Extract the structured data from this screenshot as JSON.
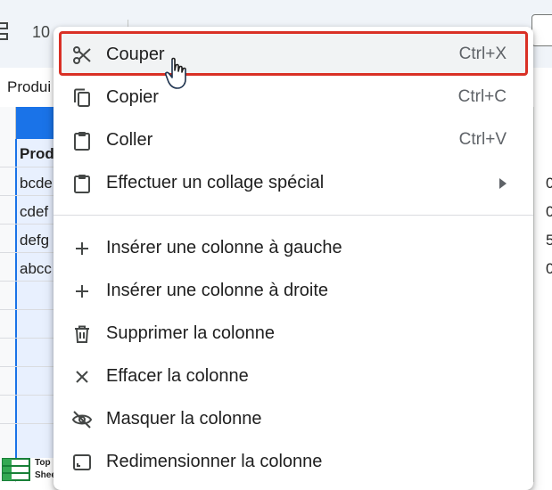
{
  "toolbar": {
    "zoom_label": "10"
  },
  "name_box": {
    "text": "Produi"
  },
  "sheet": {
    "cells": [
      {
        "text": "Prod",
        "bold": true
      },
      {
        "text": "bcde",
        "bold": false
      },
      {
        "text": "cdef",
        "bold": false
      },
      {
        "text": "defg",
        "bold": false
      },
      {
        "text": "abcc",
        "bold": false
      }
    ],
    "right_cells": [
      "0",
      "0",
      "5",
      "0"
    ]
  },
  "logo": {
    "line1": "Top",
    "line2": "Sheets"
  },
  "context_menu": {
    "items": [
      {
        "label": "Couper",
        "shortcut": "Ctrl+X",
        "icon": "scissors-icon",
        "highlighted": true
      },
      {
        "label": "Copier",
        "shortcut": "Ctrl+C",
        "icon": "copy-icon"
      },
      {
        "label": "Coller",
        "shortcut": "Ctrl+V",
        "icon": "paste-icon"
      },
      {
        "label": "Effectuer un collage spécial",
        "icon": "paste-special-icon",
        "submenu": true
      },
      {
        "label": "Insérer une colonne à gauche",
        "icon": "plus-icon"
      },
      {
        "label": "Insérer une colonne à droite",
        "icon": "plus-icon"
      },
      {
        "label": "Supprimer la colonne",
        "icon": "trash-icon"
      },
      {
        "label": "Effacer la colonne",
        "icon": "close-icon"
      },
      {
        "label": "Masquer la colonne",
        "icon": "eye-off-icon"
      },
      {
        "label": "Redimensionner la colonne",
        "icon": "resize-icon"
      }
    ]
  },
  "colors": {
    "highlight_border": "#d93025",
    "selection_blue": "#1a73e8",
    "selection_fill": "#e8f0fe"
  }
}
